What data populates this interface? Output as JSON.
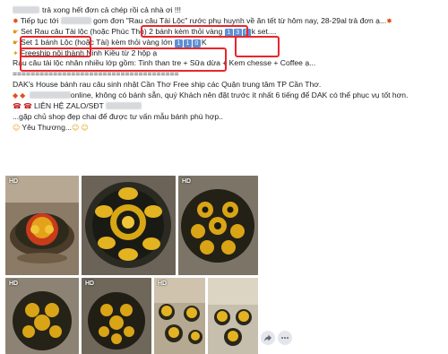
{
  "post": {
    "lines": [
      {
        "pre": "",
        "text": "trả xong hết đơn cả chép rồi cả nhà ơi !!!"
      },
      {
        "pre": "Tiếp tục tới",
        "mid": "gom đơn ",
        "quote": "\"Rau câu Tài Lộc\"",
        "post": " rước phụ huynh về ăn tết từ hôm nay, 28-29al trả đơn ạ..."
      },
      {
        "a": "Set Rau câu Tài lộc",
        "b": " (hoặc Phúc Thọ) 2 bánh kèm thỏi vàng ",
        "digits": [
          "1",
          "3",
          "0"
        ],
        "c": "k set...."
      },
      {
        "a": "Set 1 bánh Lộc (hoặc Tài) kèm thỏi vàng lớn ",
        "digits": [
          "1",
          "1",
          "0"
        ],
        "c": "K"
      },
      {
        "text": "Freeship nội thành Ninh Kiều từ 2 hộp ạ"
      },
      {
        "text": "Rau câu tài lộc nhân nhiều lớp gồm: Tinh than tre + Sữa dừa + Kem chesse + Coffee ạ..."
      },
      {
        "text": "====================================="
      },
      {
        "text": "DAK's House bánh rau câu sinh nhật Cần Thơ Free ship các Quận trung tâm TP Cần Thơ."
      },
      {
        "text": "online, không có bánh sẵn, quý Khách nên đặt trước ít nhất 6 tiếng để DAK có thể phục vụ tốt hơn."
      },
      {
        "text": "LIÊN HỆ ZALO/SĐT"
      },
      {
        "text": "...gặp chủ shop đẹp chai để được tư vấn mẫu bánh phù hợp.."
      },
      {
        "text": "Yêu Thương..."
      }
    ]
  },
  "photos": [
    {
      "label": "HD"
    },
    {
      "label": ""
    },
    {
      "label": "HD"
    },
    {
      "label": "HD"
    },
    {
      "label": "HD"
    },
    {
      "label": "HD"
    },
    {
      "label": ""
    }
  ],
  "icons": [
    "fish-icon",
    "star-icon",
    "flame-icon",
    "hand-point-icon",
    "phone-icon",
    "smile-icon",
    "share-icon",
    "more-icon"
  ],
  "colors": {
    "highlight": "#e8262b",
    "digit_box": "#5c8fd6"
  }
}
